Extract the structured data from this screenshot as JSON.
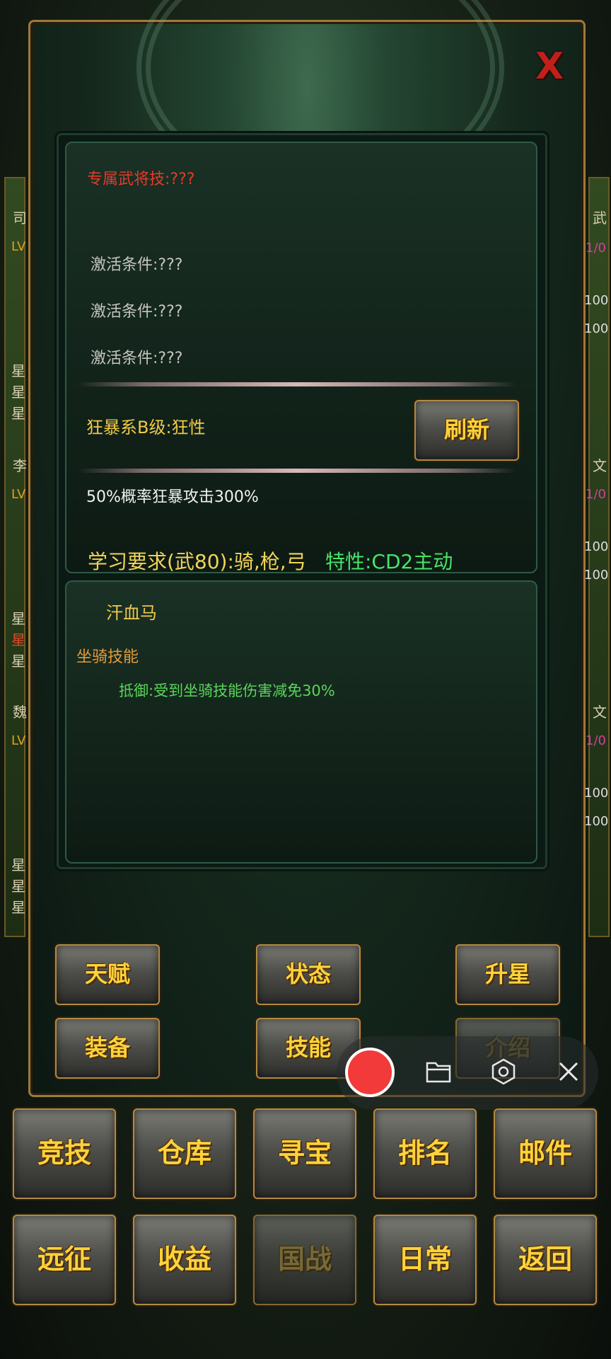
{
  "header": {
    "close_glyph": "X"
  },
  "skill": {
    "exclusive_title": "专属武将技:???",
    "conditions": [
      "激活条件:???",
      "激活条件:???",
      "激活条件:???"
    ],
    "trait_name": "狂暴系B级:狂性",
    "refresh_label": "刷新",
    "trait_desc": "50%概率狂暴攻击300%",
    "requirement": "学习要求(武80):骑,枪,弓",
    "property": "特性:CD2主动"
  },
  "mount": {
    "name": "汗血马",
    "section_title": "坐骑技能",
    "skill_desc": "抵御:受到坐骑技能伤害减免30%"
  },
  "panel_buttons": [
    "天赋",
    "状态",
    "升星",
    "装备",
    "技能",
    "介绍"
  ],
  "bottom_nav": {
    "row1": [
      "竞技",
      "仓库",
      "寻宝",
      "排名",
      "邮件"
    ],
    "row2": [
      "远征",
      "收益",
      "国战",
      "日常",
      "返回"
    ]
  },
  "background": {
    "left_labels": [
      "司",
      "LV",
      "星",
      "星",
      "星",
      "李",
      "LV",
      "星",
      "星",
      "星",
      "魏",
      "LV",
      "星",
      "星",
      "星"
    ],
    "right_labels": [
      "武",
      "文",
      "文"
    ],
    "right_values": [
      "1/0",
      "100",
      "100",
      "1/0",
      "100",
      "100",
      "1/0",
      "100",
      "100"
    ]
  },
  "recorder": {
    "folder_icon": "folder-icon",
    "settings_icon": "settings-icon",
    "close_icon": "close-icon"
  },
  "colors": {
    "accent_gold": "#f0c94a",
    "title_red": "#e53a2a",
    "property_green": "#48e468",
    "record_red": "#f23a3a"
  }
}
